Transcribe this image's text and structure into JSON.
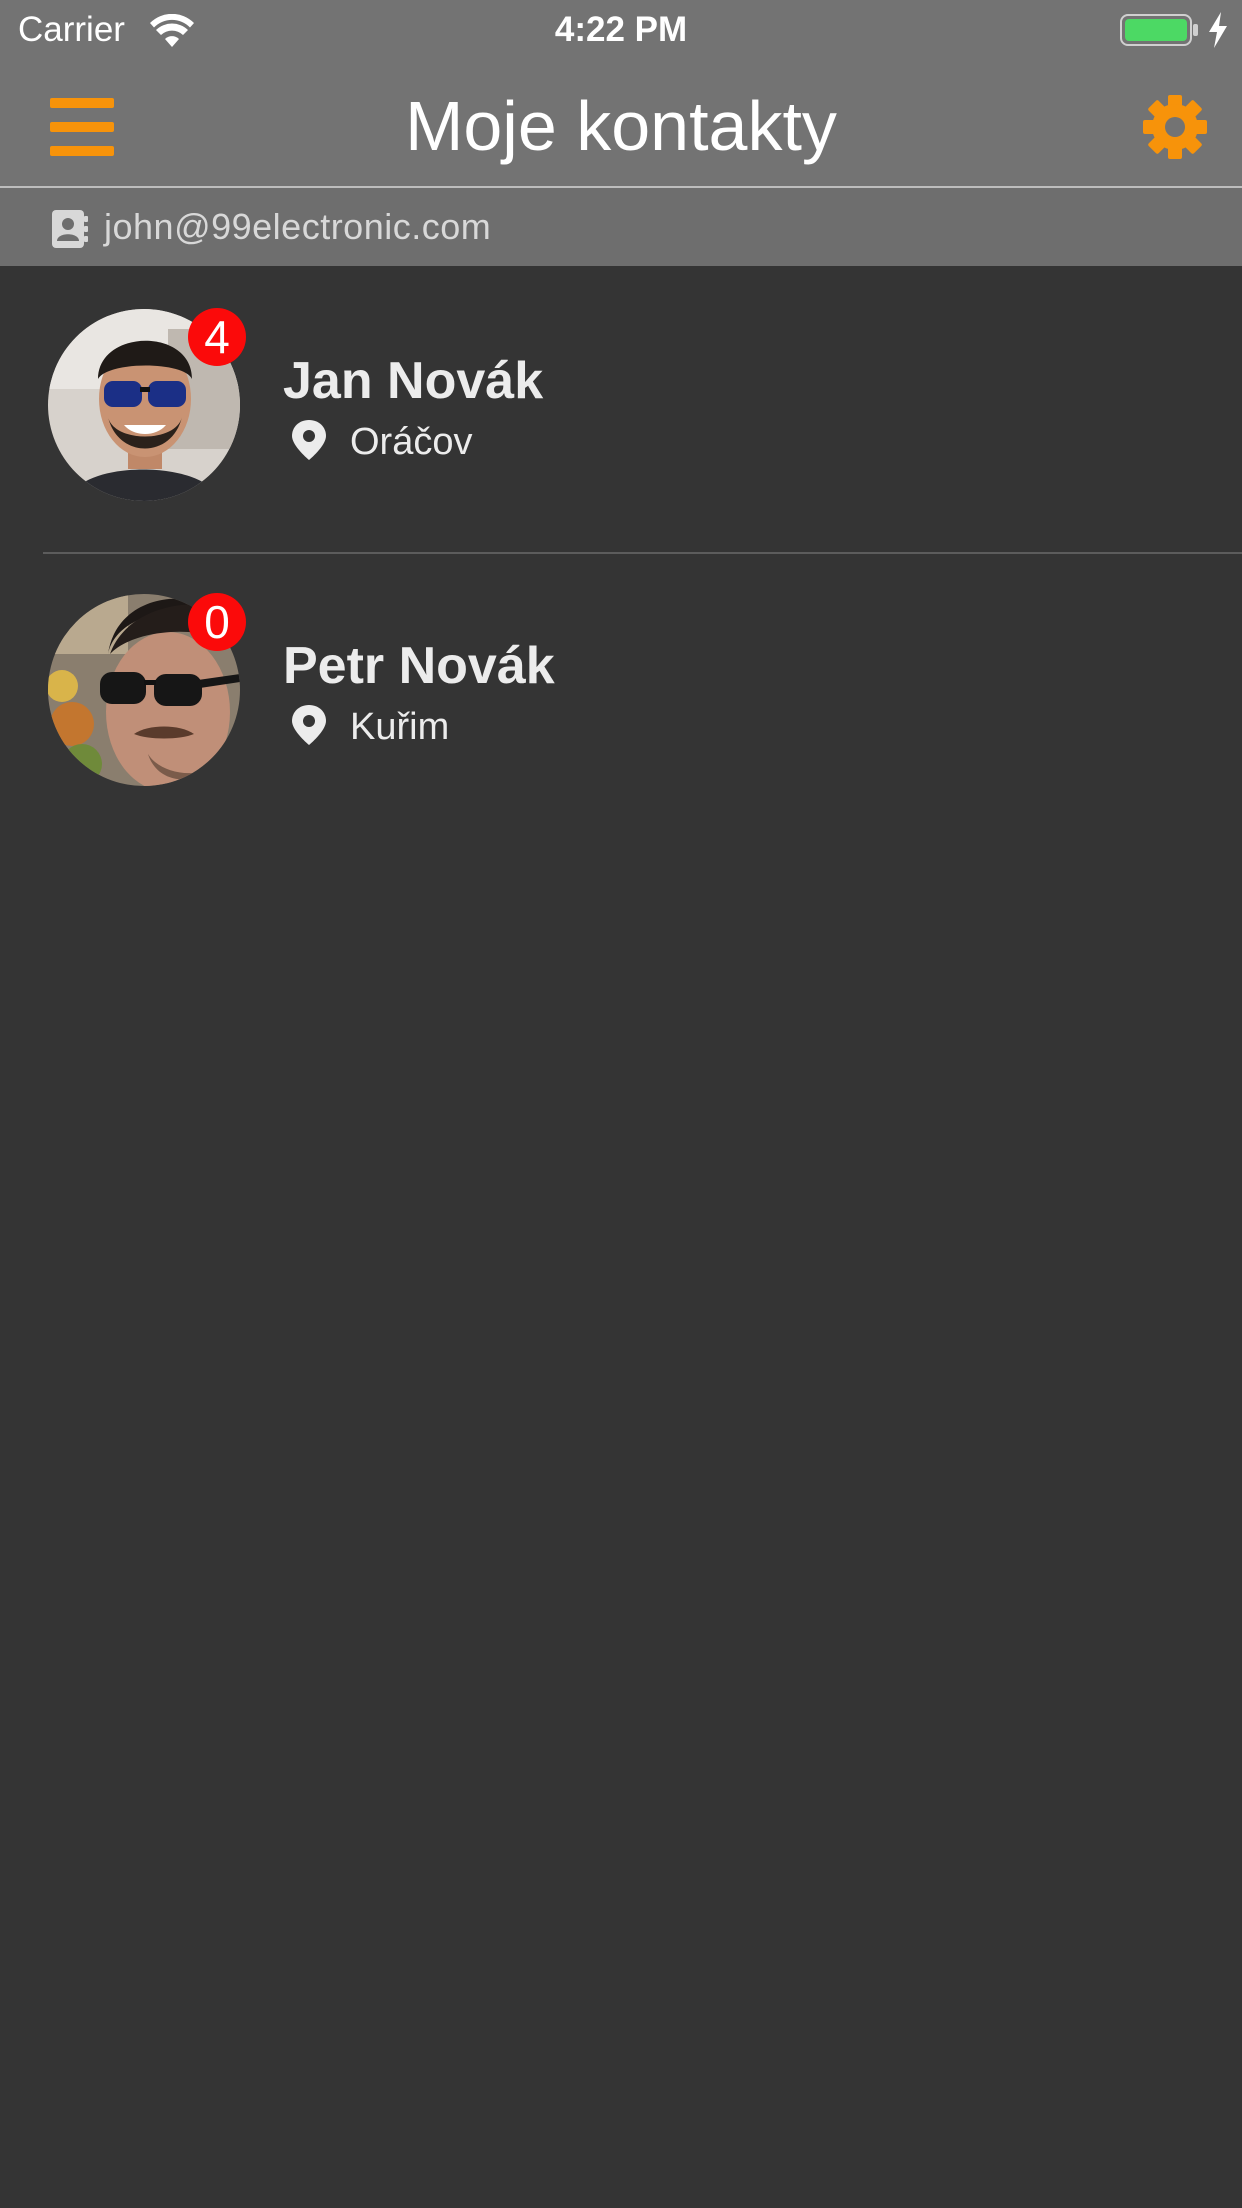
{
  "status_bar": {
    "carrier": "Carrier",
    "time": "4:22 PM",
    "battery_color": "#4cd964"
  },
  "nav_bar": {
    "title": "Moje kontakty",
    "menu_icon": "hamburger-menu-icon",
    "settings_icon": "gear-icon",
    "accent_color": "#f7930a"
  },
  "account": {
    "icon": "contact-card-icon",
    "email": "john@99electronic.com"
  },
  "contacts": [
    {
      "name": "Jan Novák",
      "city": "Oráčov",
      "unread": "4",
      "location_icon": "map-pin-icon"
    },
    {
      "name": "Petr Novák",
      "city": "Kuřim",
      "unread": "0",
      "location_icon": "map-pin-icon"
    }
  ],
  "colors": {
    "background": "#343434",
    "bar_background": "#737373",
    "badge": "#fb0a0a"
  }
}
